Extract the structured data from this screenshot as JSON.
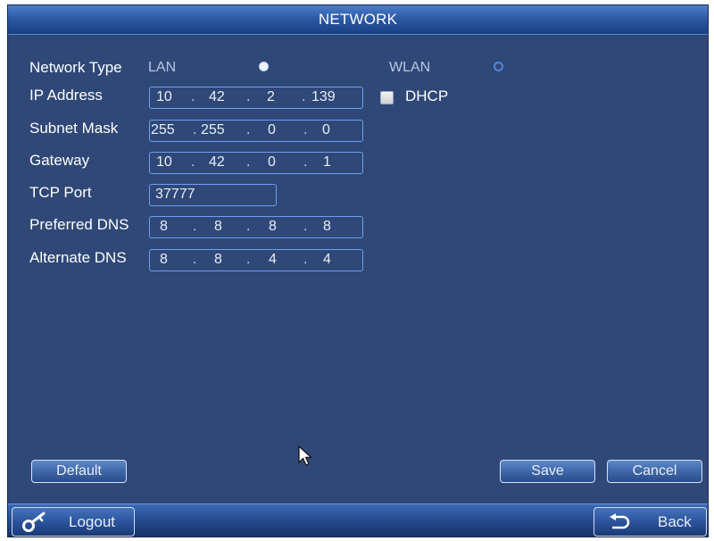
{
  "title": "NETWORK",
  "network_type": {
    "label": "Network Type",
    "options": [
      {
        "label": "LAN",
        "checked": true
      },
      {
        "label": "WLAN",
        "checked": false
      }
    ]
  },
  "ip_address": {
    "label": "IP Address",
    "octets": [
      "10",
      "42",
      "2",
      "139"
    ]
  },
  "dhcp": {
    "label": "DHCP",
    "checked": false
  },
  "subnet_mask": {
    "label": "Subnet Mask",
    "octets": [
      "255",
      "255",
      "0",
      "0"
    ]
  },
  "gateway": {
    "label": "Gateway",
    "octets": [
      "10",
      "42",
      "0",
      "1"
    ]
  },
  "tcp_port": {
    "label": "TCP Port",
    "value": "37777"
  },
  "preferred_dns": {
    "label": "Preferred DNS",
    "octets": [
      "8",
      "8",
      "8",
      "8"
    ]
  },
  "alternate_dns": {
    "label": "Alternate DNS",
    "octets": [
      "8",
      "8",
      "4",
      "4"
    ]
  },
  "buttons": {
    "default": "Default",
    "save": "Save",
    "cancel": "Cancel"
  },
  "bottom_bar": {
    "logout": "Logout",
    "back": "Back"
  },
  "icons": {
    "logout": "key-icon",
    "back": "return-arrow-icon",
    "cursor": "mouse-pointer-icon"
  },
  "colors": {
    "panel": "#2f4877",
    "field_border": "#6d9ef5",
    "title_bar": "#2c5aa6"
  }
}
